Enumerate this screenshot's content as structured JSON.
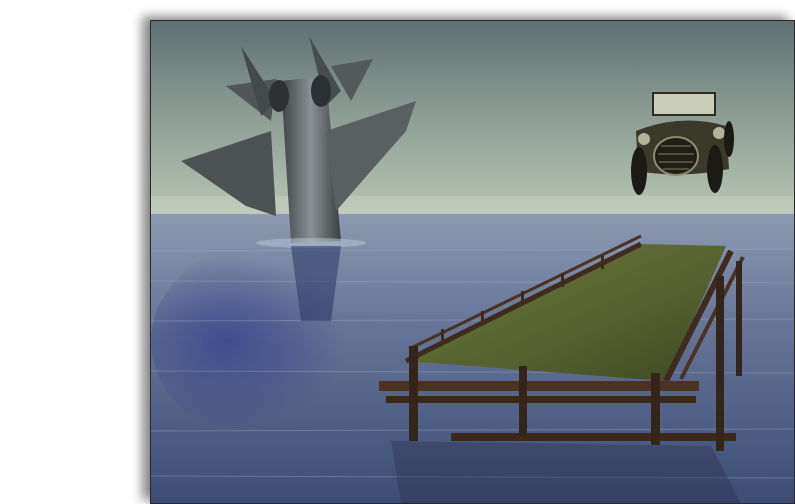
{
  "scene": {
    "description_tags": [
      "fighter-jet",
      "vintage-car",
      "wooden-pier",
      "water"
    ],
    "colors": {
      "sky_top": "#5e6f73",
      "sky_horizon": "#b9c6b6",
      "water_near": "#3c4c74",
      "water_far": "#8d9ab0",
      "pier_deck": "#5a6a33",
      "pier_wood": "#4a3322",
      "jet_metal": "#5f6466"
    }
  }
}
